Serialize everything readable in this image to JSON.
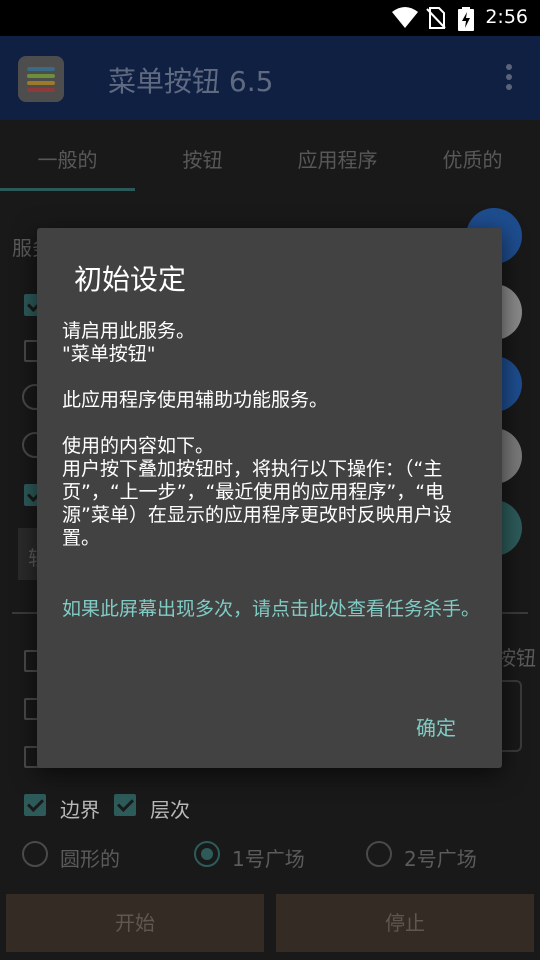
{
  "status_bar": {
    "time": "2:56",
    "icons": [
      "wifi-icon",
      "no-sim-icon",
      "battery-charging-icon"
    ]
  },
  "app_bar": {
    "title": "菜单按钮 6.5",
    "logo_icon": "app-logo-icon",
    "menu_icon": "overflow-menu-icon"
  },
  "tabs": [
    {
      "label": "一般的",
      "selected": true
    },
    {
      "label": "按钮",
      "selected": false
    },
    {
      "label": "应用程序",
      "selected": false
    },
    {
      "label": "优质的",
      "selected": false
    }
  ],
  "background": {
    "service_label_partial": "服务",
    "button_label_partial": "按钮",
    "dropdown_partial": "轻",
    "checkbox_border_label": "边界",
    "checkbox_level_label": "层次",
    "radio_circle_label": "圆形的",
    "radio_square1_label": "1号广场",
    "radio_square2_label": "2号广场",
    "start_button": "开始",
    "stop_button": "停止"
  },
  "dialog": {
    "title": "初始设定",
    "body_line1": "请启用此服务。",
    "body_line2": "\"菜单按钮\"",
    "body_line3": "此应用程序使用辅助功能服务。",
    "body_line4": "使用的内容如下。",
    "body_line5": "用户按下叠加按钮时，将执行以下操作：（“主页”，“上一步”，“最近使用的应用程序”，“电源”菜单）在显示的应用程序更改时反映用户设置。",
    "link_text": "如果此屏幕出现多次，请点击此处查看任务杀手。",
    "ok_button": "确定"
  },
  "colors": {
    "app_bar": "#102043",
    "dialog_bg": "#424242",
    "accent": "#80cbc4"
  }
}
